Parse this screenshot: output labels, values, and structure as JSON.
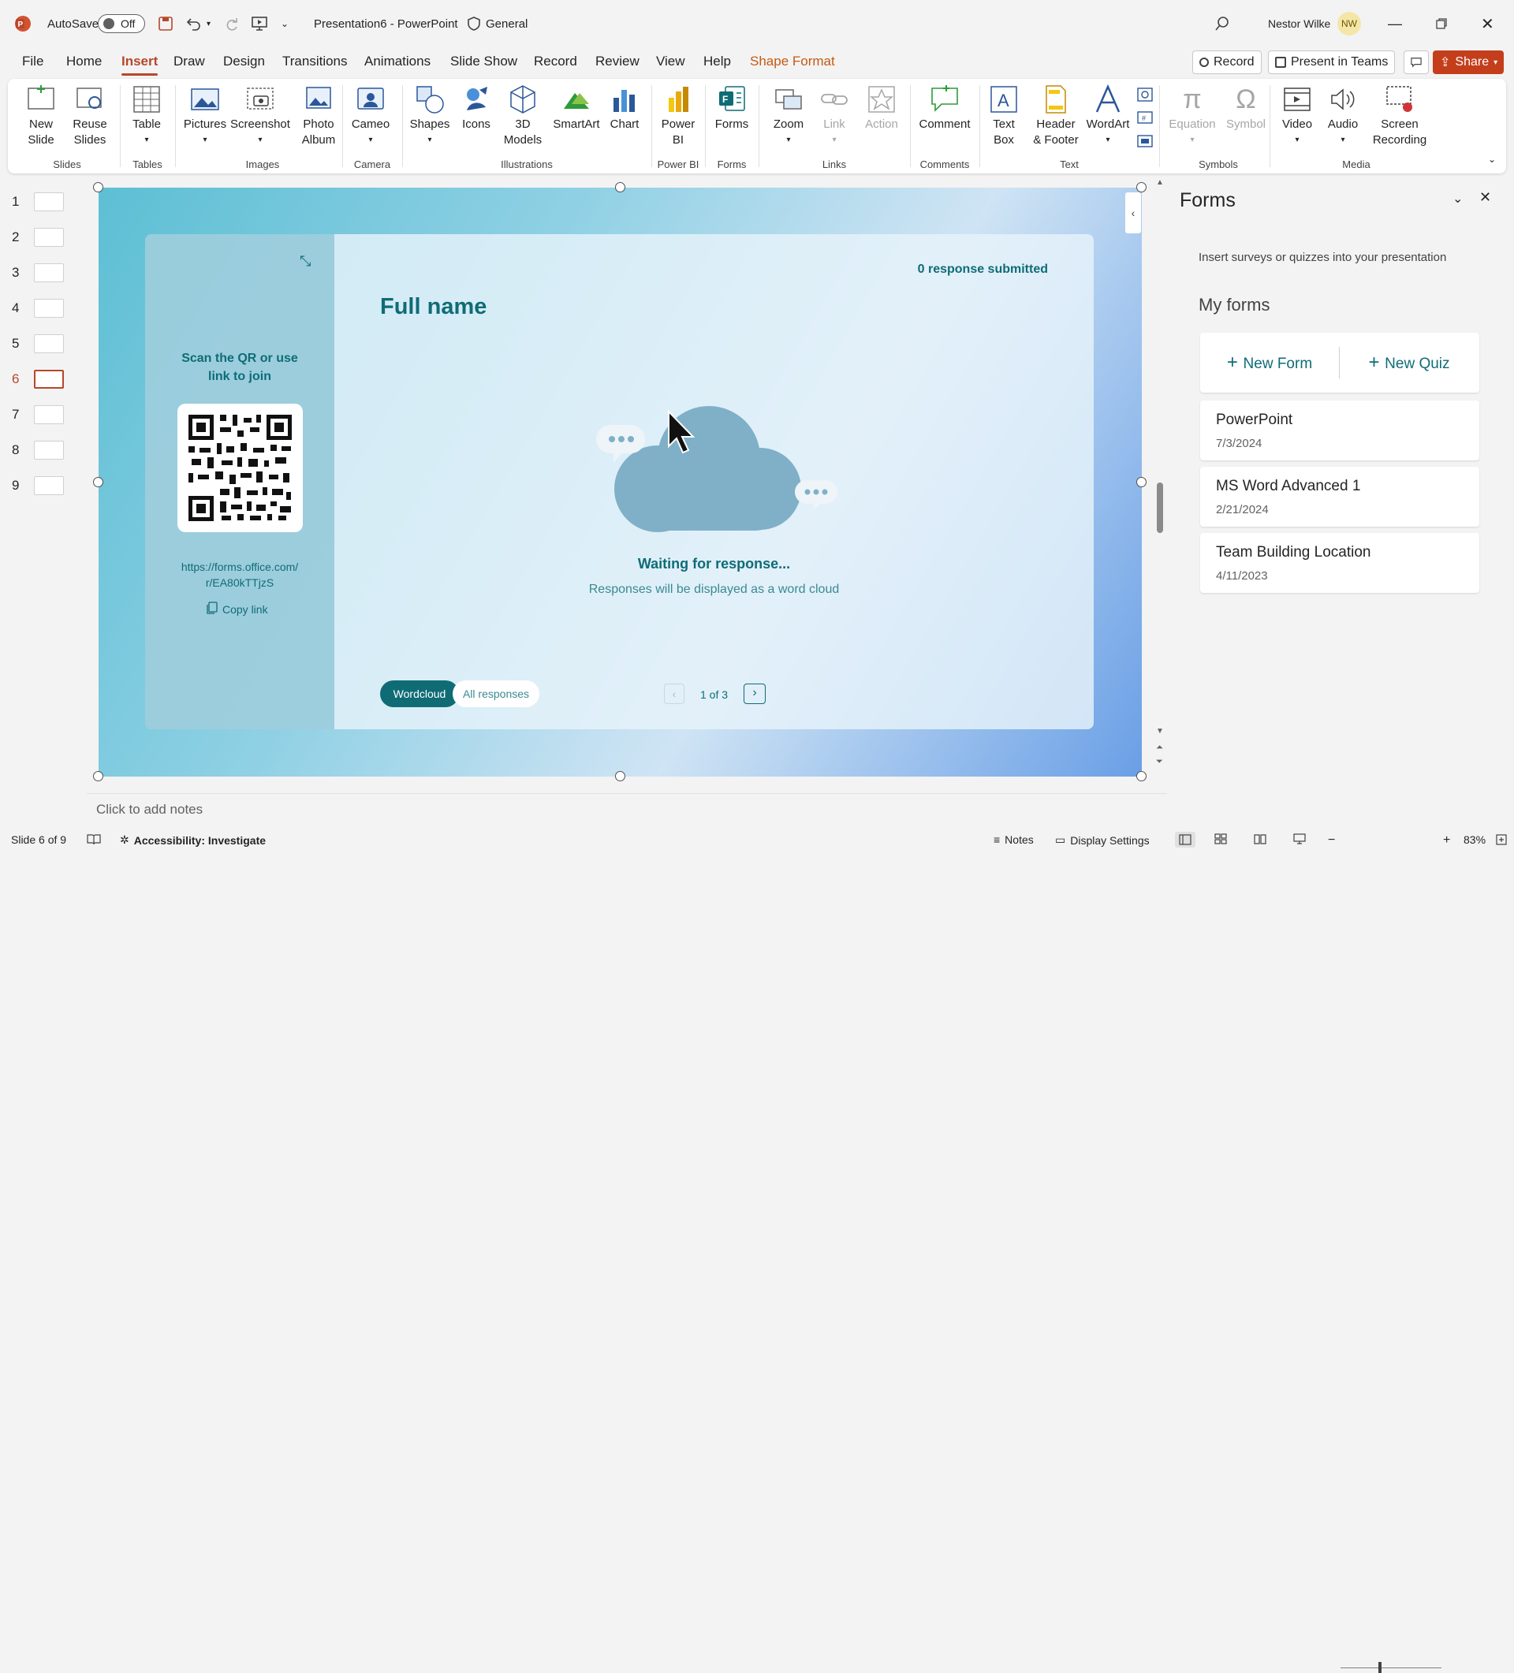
{
  "titlebar": {
    "autosave_label": "AutoSave",
    "autosave_state": "Off",
    "doc_title": "Presentation6 - PowerPoint",
    "sensitivity": "General",
    "user_name": "Nestor Wilke",
    "user_initials": "NW"
  },
  "tabs": [
    "File",
    "Home",
    "Insert",
    "Draw",
    "Design",
    "Transitions",
    "Animations",
    "Slide Show",
    "Record",
    "Review",
    "View",
    "Help",
    "Shape Format"
  ],
  "tab_actions": {
    "record": "Record",
    "present": "Present in Teams",
    "share": "Share"
  },
  "ribbon": {
    "groups": [
      "Slides",
      "Tables",
      "Images",
      "Camera",
      "Illustrations",
      "Power BI",
      "Forms",
      "Links",
      "Comments",
      "Text",
      "Symbols",
      "Media"
    ],
    "items": {
      "new_slide": [
        "New",
        "Slide"
      ],
      "reuse_slides": [
        "Reuse",
        "Slides"
      ],
      "table": "Table",
      "pictures": "Pictures",
      "screenshot": "Screenshot",
      "photo_album": [
        "Photo",
        "Album"
      ],
      "cameo": "Cameo",
      "shapes": "Shapes",
      "icons": "Icons",
      "models_3d": [
        "3D",
        "Models"
      ],
      "smartart": "SmartArt",
      "chart": "Chart",
      "power_bi": [
        "Power",
        "BI"
      ],
      "forms": "Forms",
      "zoom": "Zoom",
      "link": "Link",
      "action": "Action",
      "comment": "Comment",
      "text_box": [
        "Text",
        "Box"
      ],
      "header_footer": [
        "Header",
        "& Footer"
      ],
      "wordart": "WordArt",
      "equation": "Equation",
      "symbol": "Symbol",
      "video": "Video",
      "audio": "Audio",
      "screen_recording": [
        "Screen",
        "Recording"
      ]
    }
  },
  "thumbnails": [
    "1",
    "2",
    "3",
    "4",
    "5",
    "6",
    "7",
    "8",
    "9"
  ],
  "current_slide_index": 6,
  "slide": {
    "responses": "0 response submitted",
    "question": "Full name",
    "scan_text": [
      "Scan the QR or use",
      "link to join"
    ],
    "link": [
      "https://forms.office.com/",
      "r/EA80kTTjzS"
    ],
    "copy_link": "Copy link",
    "waiting": "Waiting for response...",
    "hint": "Responses will be displayed as a word cloud",
    "tab_wordcloud": "Wordcloud",
    "tab_all": "All responses",
    "pager": "1 of 3"
  },
  "notes_placeholder": "Click to add notes",
  "forms_pane": {
    "title": "Forms",
    "subtitle": "Insert surveys or quizzes into your presentation",
    "my_forms": "My forms",
    "new_form": "New Form",
    "new_quiz": "New Quiz",
    "forms": [
      {
        "name": "PowerPoint",
        "date": "7/3/2024"
      },
      {
        "name": "MS Word Advanced 1",
        "date": "2/21/2024"
      },
      {
        "name": "Team Building Location",
        "date": "4/11/2023"
      }
    ]
  },
  "status": {
    "slide_counter": "Slide 6 of 9",
    "accessibility": "Accessibility: Investigate",
    "notes": "Notes",
    "display_settings": "Display Settings",
    "zoom": "83%"
  },
  "colors": {
    "accent": "#b7472a",
    "share": "#c43e1c",
    "teal": "#0f6c75"
  }
}
